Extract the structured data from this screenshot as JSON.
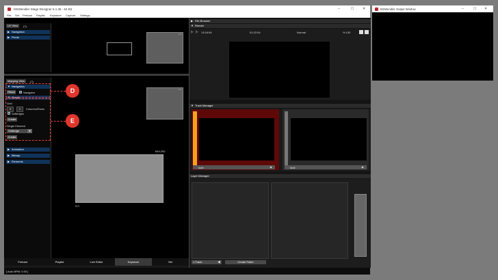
{
  "main_window": {
    "title": "MXWendler Stage Designer 6.1.35 - 64 Bit",
    "controls": [
      "–",
      "☐",
      "✕"
    ]
  },
  "menu": [
    "File",
    "Set",
    "Preload",
    "Playlist",
    "Keystone",
    "Capture",
    "Settings"
  ],
  "uv_view": {
    "tab": "UV View",
    "tab_count": "(?)",
    "items": [
      "Navigation",
      "Pivots"
    ]
  },
  "mapping_view": {
    "tab": "Mapping View",
    "tab_count": "(?)",
    "navigation_header": "Navigation",
    "reset_label": "Reset",
    "navigator_label": "Navigator",
    "create_header": "Create",
    "grid_label": "Grid",
    "grid_cols": "2",
    "grid_rows": "1",
    "columns_rows_label": "Columns/Rows",
    "softedges_label": "Softedges",
    "create_button": "Create",
    "single_element_label": "Single Element",
    "single_select_value": "Softedge",
    "single_create_button": "Create",
    "sections": [
      "Animation",
      "Bitmap",
      "Elements"
    ],
    "coord_top_right": "644,252",
    "coord_bottom_left": "0,0"
  },
  "callouts": [
    "D",
    "E"
  ],
  "bottom_tabs": [
    "Preload",
    "Playlist",
    "Live Editor",
    "Keystone",
    "Set"
  ],
  "status": "[ Auto BPM: 0.00 ]",
  "file_browser": {
    "title": "File Browser"
  },
  "render": {
    "title": "Render",
    "time_left": "13:16:54",
    "time_mid": "01:22:04",
    "mode": "Normal",
    "percent": "% 100"
  },
  "track_manager": {
    "title": "Track Manager",
    "tracks": [
      {
        "label": "fade"
      },
      {
        "label": "fade"
      }
    ]
  },
  "layer_manager": {
    "title": "Layer Manager",
    "track_select": "1.Track",
    "create_patch": "Create Patch"
  },
  "output_window": {
    "title": "MXWendler Output Window",
    "controls": [
      "–",
      "☐",
      "✕"
    ]
  },
  "colors": {
    "header_blue": "#10335a",
    "accent_red": "#e0362c",
    "track_active": "#6a0a0a",
    "fader_orange": "#f7a21b"
  }
}
